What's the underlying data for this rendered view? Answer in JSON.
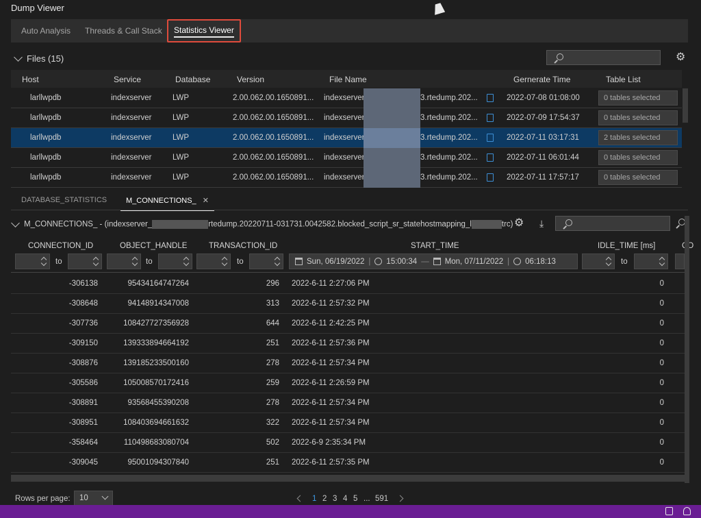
{
  "window": {
    "title": "Dump Viewer"
  },
  "top_tabs": [
    {
      "label": "Auto Analysis"
    },
    {
      "label": "Threads & Call Stack"
    },
    {
      "label": "Statistics Viewer"
    }
  ],
  "files": {
    "heading": "Files (15)",
    "columns": [
      "Host",
      "Service",
      "Database",
      "Version",
      "File Name",
      "Gernerate Time",
      "Table List"
    ],
    "rows": [
      {
        "host": "larllwpdb",
        "service": "indexserver",
        "database": "LWP",
        "version": "2.00.062.00.1650891...",
        "file_prefix": "indexserver",
        "file_suffix": "3.rtedump.202...",
        "time": "2022-07-08 01:08:00",
        "tables": "0 tables selected"
      },
      {
        "host": "larllwpdb",
        "service": "indexserver",
        "database": "LWP",
        "version": "2.00.062.00.1650891...",
        "file_prefix": "indexserver",
        "file_suffix": "3.rtedump.202...",
        "time": "2022-07-09 17:54:37",
        "tables": "0 tables selected"
      },
      {
        "host": "larllwpdb",
        "service": "indexserver",
        "database": "LWP",
        "version": "2.00.062.00.1650891...",
        "file_prefix": "indexserver",
        "file_suffix": "3.rtedump.202...",
        "time": "2022-07-11 03:17:31",
        "tables": "2 tables selected"
      },
      {
        "host": "larllwpdb",
        "service": "indexserver",
        "database": "LWP",
        "version": "2.00.062.00.1650891...",
        "file_prefix": "indexserver",
        "file_suffix": "3.rtedump.202...",
        "time": "2022-07-11 06:01:44",
        "tables": "0 tables selected"
      },
      {
        "host": "larllwpdb",
        "service": "indexserver",
        "database": "LWP",
        "version": "2.00.062.00.1650891...",
        "file_prefix": "indexserver",
        "file_suffix": "3.rtedump.202...",
        "time": "2022-07-11 17:57:17",
        "tables": "0 tables selected"
      }
    ]
  },
  "sub_tabs": [
    {
      "label": "DATABASE_STATISTICS"
    },
    {
      "label": "M_CONNECTIONS_"
    }
  ],
  "dump": {
    "title_prefix": "M_CONNECTIONS_ - (indexserver_",
    "title_middle": "rtedump.20220711-031731.0042582.blocked_script_sr_statehostmapping_l",
    "title_suffix": "trc)"
  },
  "grid": {
    "columns": [
      "CONNECTION_ID",
      "OBJECT_HANDLE",
      "TRANSACTION_ID",
      "START_TIME",
      "IDLE_TIME [ms]",
      "CO"
    ],
    "to_label": "to",
    "date_filter": {
      "from_date": "Sun, 06/19/2022",
      "from_time": "15:00:34",
      "to_date": "Mon, 07/11/2022",
      "to_time": "06:18:13"
    },
    "rows": [
      {
        "connection_id": "-306138",
        "object_handle": "95434164747264",
        "transaction_id": "296",
        "start_time": "2022-6-11 2:27:06 PM",
        "idle_time": "0"
      },
      {
        "connection_id": "-308648",
        "object_handle": "94148914347008",
        "transaction_id": "313",
        "start_time": "2022-6-11 2:57:32 PM",
        "idle_time": "0"
      },
      {
        "connection_id": "-307736",
        "object_handle": "108427727356928",
        "transaction_id": "644",
        "start_time": "2022-6-11 2:42:25 PM",
        "idle_time": "0"
      },
      {
        "connection_id": "-309150",
        "object_handle": "139333894664192",
        "transaction_id": "251",
        "start_time": "2022-6-11 2:57:36 PM",
        "idle_time": "0"
      },
      {
        "connection_id": "-308876",
        "object_handle": "139185233500160",
        "transaction_id": "278",
        "start_time": "2022-6-11 2:57:34 PM",
        "idle_time": "0"
      },
      {
        "connection_id": "-305586",
        "object_handle": "105008570172416",
        "transaction_id": "259",
        "start_time": "2022-6-11 2:26:59 PM",
        "idle_time": "0"
      },
      {
        "connection_id": "-308891",
        "object_handle": "93568455390208",
        "transaction_id": "278",
        "start_time": "2022-6-11 2:57:34 PM",
        "idle_time": "0"
      },
      {
        "connection_id": "-308951",
        "object_handle": "108403694661632",
        "transaction_id": "322",
        "start_time": "2022-6-11 2:57:34 PM",
        "idle_time": "0"
      },
      {
        "connection_id": "-358464",
        "object_handle": "110498683080704",
        "transaction_id": "502",
        "start_time": "2022-6-9 2:35:34 PM",
        "idle_time": "0"
      },
      {
        "connection_id": "-309045",
        "object_handle": "95001094307840",
        "transaction_id": "251",
        "start_time": "2022-6-11 2:57:35 PM",
        "idle_time": "0"
      }
    ]
  },
  "pagination": {
    "rows_per_page_label": "Rows per page:",
    "rows_per_page": "10",
    "pages": [
      "1",
      "2",
      "3",
      "4",
      "5",
      "...",
      "591"
    ]
  },
  "colors": {
    "accent": "#3d9ae8",
    "selected_row": "#0d3a63",
    "status_bar": "#6a1d93",
    "highlight_border": "#e04b3c"
  }
}
